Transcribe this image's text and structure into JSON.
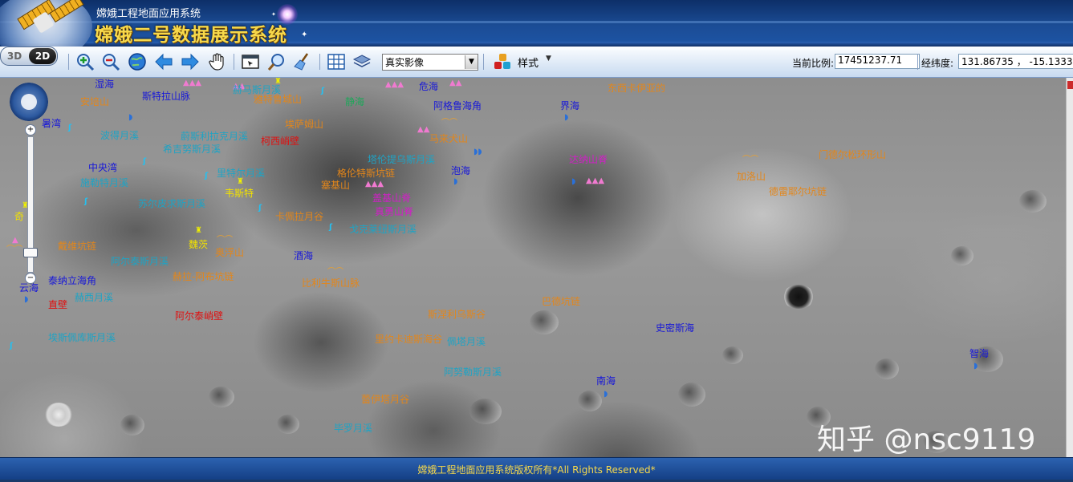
{
  "header": {
    "org_name": "嫦娥工程地面应用系统",
    "system_title": "嫦娥二号数据展示系统"
  },
  "toolbar": {
    "view_3d": "3D",
    "view_2d": "2D",
    "layer_select_value": "真实影像",
    "style_label": "样式",
    "scale_label": "当前比例:",
    "scale_value": "17451237.71",
    "lonlat_label": "经纬度:",
    "lonlat_value": "131.86735 ， -15.13337",
    "icons": [
      "zoom-in-icon",
      "zoom-out-icon",
      "globe-icon",
      "back-arrow-icon",
      "forward-arrow-icon",
      "pan-hand-icon",
      "select-region-icon",
      "magnifier-icon",
      "clear-broom-icon",
      "grid-icon",
      "layers-icon",
      "style-icon"
    ]
  },
  "map": {
    "labels": [
      {
        "text": "湿海",
        "color": "blue"
      },
      {
        "text": "安培山",
        "color": "orange"
      },
      {
        "text": "斯特拉山脉",
        "color": "blue"
      },
      {
        "text": "赫马斯月溪",
        "color": "cyan"
      },
      {
        "text": "危海",
        "color": "blue"
      },
      {
        "text": "东西卡伊亚的",
        "color": "orange"
      },
      {
        "text": "静海",
        "color": "green"
      },
      {
        "text": "阿格鲁海角",
        "color": "blue"
      },
      {
        "text": "界海",
        "color": "blue"
      },
      {
        "text": "雅特鲁城山",
        "color": "orange"
      },
      {
        "text": "埃萨姆山",
        "color": "orange"
      },
      {
        "text": "暑湾",
        "color": "blue"
      },
      {
        "text": "波得月溪",
        "color": "cyan"
      },
      {
        "text": "蔚斯利拉克月溪",
        "color": "cyan"
      },
      {
        "text": "柯西峭壁",
        "color": "red"
      },
      {
        "text": "马来犬山",
        "color": "orange"
      },
      {
        "text": "希吉努斯月溪",
        "color": "cyan"
      },
      {
        "text": "塔伦提乌斯月溪",
        "color": "cyan"
      },
      {
        "text": "达纳山脊",
        "color": "magenta"
      },
      {
        "text": "门德尔松环形山",
        "color": "orange"
      },
      {
        "text": "中央湾",
        "color": "blue"
      },
      {
        "text": "里特尔月溪",
        "color": "cyan"
      },
      {
        "text": "格伦特斯坑链",
        "color": "orange"
      },
      {
        "text": "泡海",
        "color": "blue"
      },
      {
        "text": "加洛山",
        "color": "orange"
      },
      {
        "text": "施勒特月溪",
        "color": "cyan"
      },
      {
        "text": "韦斯特",
        "color": "yellow"
      },
      {
        "text": "塞基山",
        "color": "orange"
      },
      {
        "text": "德雷耶尔坑链",
        "color": "orange"
      },
      {
        "text": "盖基山脊",
        "color": "magenta"
      },
      {
        "text": "真勇山脊",
        "color": "magenta"
      },
      {
        "text": "苏尔皮求斯月溪",
        "color": "cyan"
      },
      {
        "text": "奇",
        "color": "yellow"
      },
      {
        "text": "卡佩拉月谷",
        "color": "orange"
      },
      {
        "text": "戈克莱纽斯月溪",
        "color": "cyan"
      },
      {
        "text": "戴维坑链",
        "color": "orange"
      },
      {
        "text": "魏茨",
        "color": "yellow"
      },
      {
        "text": "奥浮山",
        "color": "orange"
      },
      {
        "text": "阿尔泰斯月溪",
        "color": "cyan"
      },
      {
        "text": "酒海",
        "color": "blue"
      },
      {
        "text": "赫拉-阿布坑链",
        "color": "orange"
      },
      {
        "text": "比利牛斯山脉",
        "color": "orange"
      },
      {
        "text": "泰纳立海角",
        "color": "blue"
      },
      {
        "text": "云海",
        "color": "blue"
      },
      {
        "text": "赫西月溪",
        "color": "cyan"
      },
      {
        "text": "直壁",
        "color": "red"
      },
      {
        "text": "阿尔泰峭壁",
        "color": "red"
      },
      {
        "text": "斯涅利乌斯谷",
        "color": "orange"
      },
      {
        "text": "巴德坑链",
        "color": "orange"
      },
      {
        "text": "史密斯海",
        "color": "blue"
      },
      {
        "text": "埃斯佩库斯月溪",
        "color": "cyan"
      },
      {
        "text": "里约卡迪斯海谷",
        "color": "orange"
      },
      {
        "text": "佩塔月溪",
        "color": "cyan"
      },
      {
        "text": "智海",
        "color": "blue"
      },
      {
        "text": "阿努勒斯月溪",
        "color": "cyan"
      },
      {
        "text": "南海",
        "color": "blue"
      },
      {
        "text": "蕾伊塔月谷",
        "color": "orange"
      },
      {
        "text": "毕罗月溪",
        "color": "cyan"
      }
    ],
    "label_colors": {
      "blue": "#1818d8",
      "cyan": "#1fa3c4",
      "orange": "#e3861a",
      "red": "#e01010",
      "magenta": "#d21ec8",
      "green": "#1fa65a",
      "yellow": "#f2e200"
    }
  },
  "navigation": {
    "zoom_plus": "+",
    "zoom_minus": "−",
    "zoom_level_fraction": 0.18
  },
  "watermark": "知乎 @nsc9119",
  "footer": {
    "copyright": "嫦娥工程地面应用系统版权所有*All Rights Reserved*"
  }
}
